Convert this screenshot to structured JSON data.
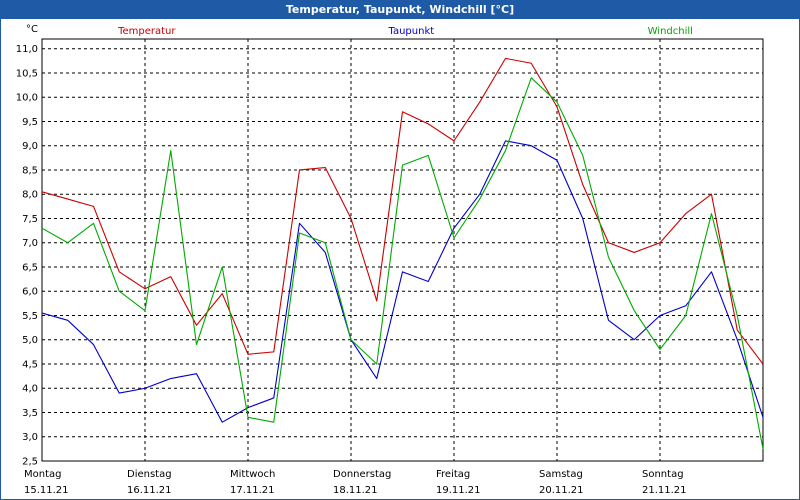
{
  "window": {
    "title": "Temperatur, Taupunkt, Windchill [°C]"
  },
  "chart_data": {
    "type": "line",
    "title": "Temperatur, Taupunkt, Windchill [°C]",
    "ylabel": "°C",
    "ylim": [
      2.5,
      11.2
    ],
    "y_ticks": [
      "11,0",
      "10,5",
      "10,0",
      "9,5",
      "9,0",
      "8,5",
      "8,0",
      "7,5",
      "7,0",
      "6,5",
      "6,0",
      "5,5",
      "5,0",
      "4,5",
      "4,0",
      "3,5",
      "3,0",
      "2,5"
    ],
    "x_day_labels": [
      {
        "day": "Montag",
        "date": "15.11.21"
      },
      {
        "day": "Dienstag",
        "date": "16.11.21"
      },
      {
        "day": "Mittwoch",
        "date": "17.11.21"
      },
      {
        "day": "Donnerstag",
        "date": "18.11.21"
      },
      {
        "day": "Freitag",
        "date": "19.11.21"
      },
      {
        "day": "Samstag",
        "date": "20.11.21"
      },
      {
        "day": "Sonntag",
        "date": "21.11.21"
      }
    ],
    "grid": true,
    "x": [
      0,
      0.25,
      0.5,
      0.75,
      1,
      1.25,
      1.5,
      1.75,
      2,
      2.25,
      2.5,
      2.75,
      3,
      3.25,
      3.5,
      3.75,
      4,
      4.25,
      4.5,
      4.75,
      5,
      5.25,
      5.5,
      5.75,
      6,
      6.25,
      6.5,
      6.75,
      7
    ],
    "series": [
      {
        "name": "Temperatur",
        "color": "#cc0000",
        "values": [
          8.05,
          7.9,
          7.75,
          6.4,
          6.05,
          6.3,
          5.3,
          5.95,
          4.7,
          4.75,
          8.5,
          8.55,
          7.5,
          5.8,
          9.7,
          9.45,
          9.1,
          9.9,
          10.8,
          10.7,
          9.8,
          8.2,
          7.0,
          6.8,
          7.0,
          7.6,
          8.0,
          5.2,
          4.5
        ]
      },
      {
        "name": "Taupunkt",
        "color": "#0000cc",
        "values": [
          5.55,
          5.4,
          4.9,
          3.9,
          4.0,
          4.2,
          4.3,
          3.3,
          3.6,
          3.8,
          7.4,
          6.8,
          5.0,
          4.2,
          6.4,
          6.2,
          7.3,
          8.0,
          9.1,
          9.0,
          8.7,
          7.5,
          5.4,
          5.0,
          5.5,
          5.7,
          6.4,
          5.0,
          3.4
        ]
      },
      {
        "name": "Windchill",
        "color": "#00aa00",
        "values": [
          7.3,
          7.0,
          7.4,
          6.0,
          5.6,
          8.9,
          4.9,
          6.5,
          3.4,
          3.3,
          7.2,
          7.0,
          5.0,
          4.5,
          8.6,
          8.8,
          7.1,
          7.9,
          8.9,
          10.4,
          9.9,
          8.8,
          6.7,
          5.6,
          4.8,
          5.5,
          7.6,
          5.5,
          2.75
        ]
      }
    ]
  }
}
